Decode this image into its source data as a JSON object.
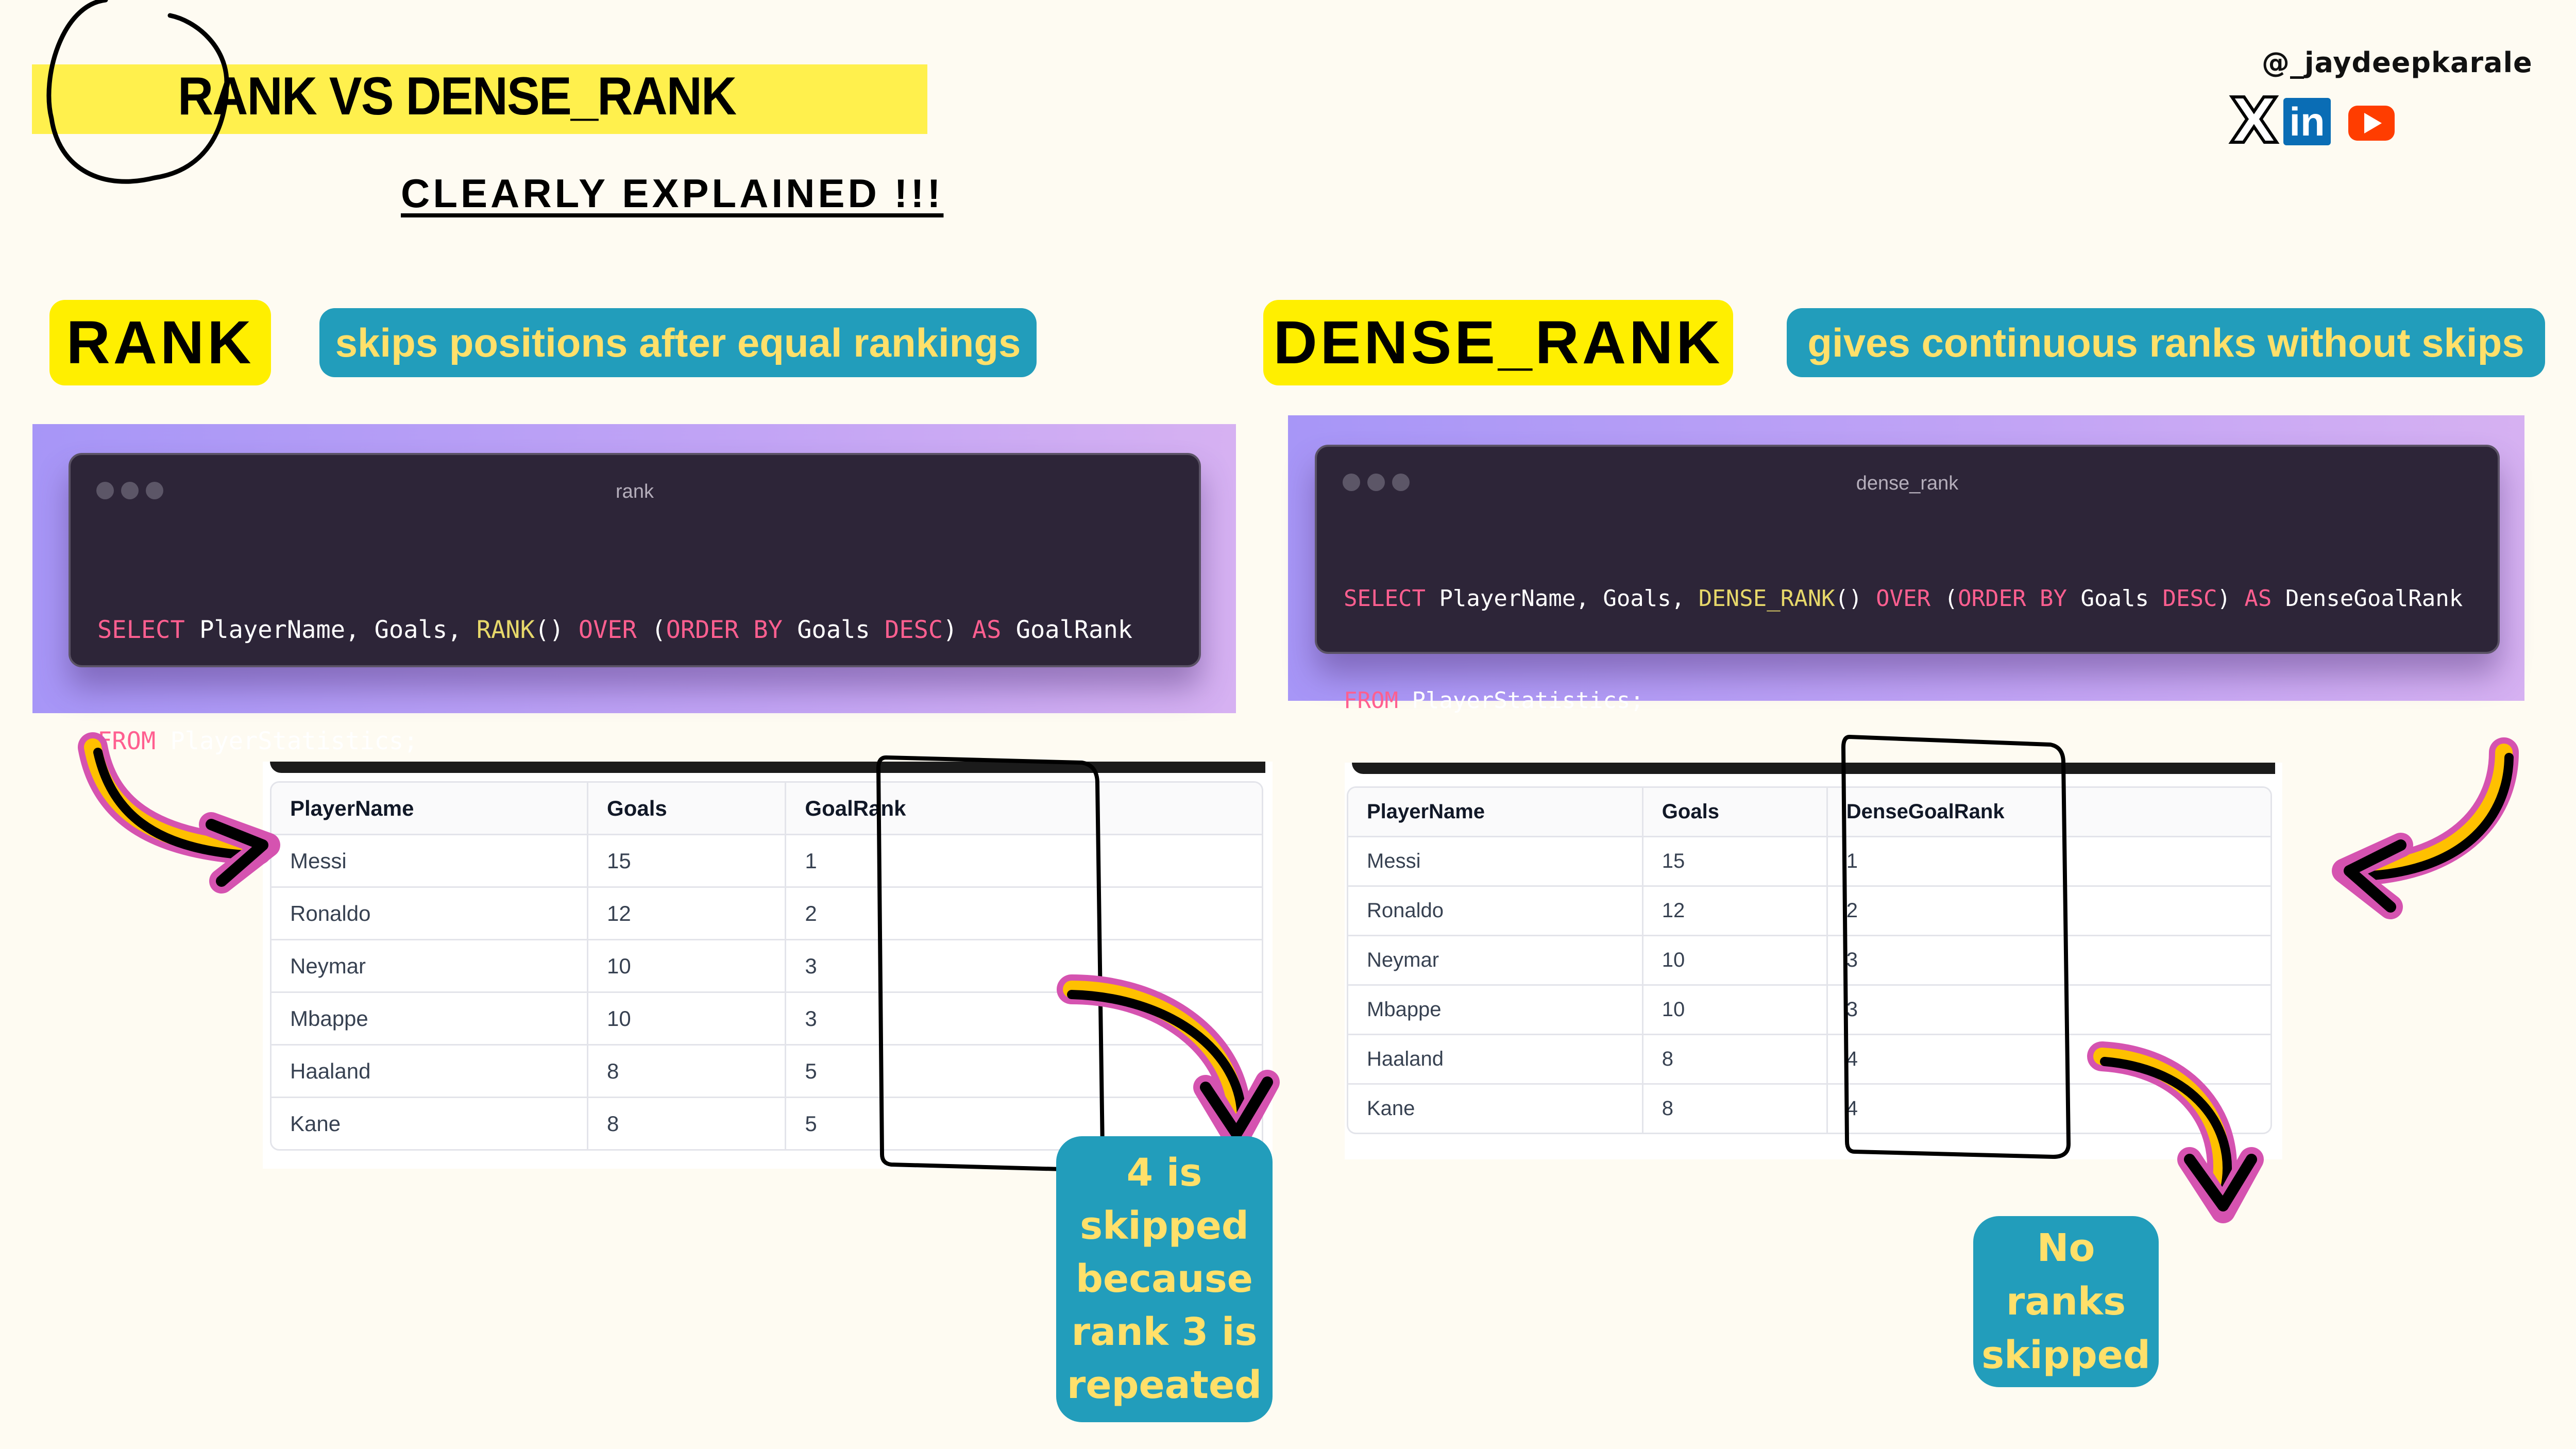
{
  "header": {
    "title": "RANK VS DENSE_RANK",
    "subtitle": "CLEARLY EXPLAINED !!!",
    "handle": "@_jaydeepkarale",
    "socials": [
      {
        "name": "x",
        "icon": "x-logo-icon",
        "glyph": "X"
      },
      {
        "name": "linkedin",
        "icon": "linkedin-icon",
        "glyph": "in"
      },
      {
        "name": "youtube",
        "icon": "youtube-icon",
        "glyph": ""
      }
    ]
  },
  "colors": {
    "background": "#fefbf2",
    "title_highlight": "#fff04d",
    "label_yellow": "#ffef00",
    "label_blue": "#229dbb",
    "label_text_yellow": "#ffe06a",
    "code_bg": "#2d2538",
    "code_keyword": "#ff5f90",
    "code_function": "#e7d86a",
    "arrow_pink": "#d553b0",
    "arrow_yellow": "#ffc000"
  },
  "rank": {
    "label": "RANK",
    "description": "skips positions after equal rankings",
    "code_window_title": "rank",
    "code": {
      "line1": [
        {
          "t": "SELECT",
          "c": "kw"
        },
        {
          "t": " PlayerName, Goals, ",
          "c": ""
        },
        {
          "t": "RANK",
          "c": "fn"
        },
        {
          "t": "() ",
          "c": ""
        },
        {
          "t": "OVER",
          "c": "kw"
        },
        {
          "t": " (",
          "c": ""
        },
        {
          "t": "ORDER BY",
          "c": "kw"
        },
        {
          "t": " Goals ",
          "c": ""
        },
        {
          "t": "DESC",
          "c": "kw"
        },
        {
          "t": ") ",
          "c": ""
        },
        {
          "t": "AS",
          "c": "kw"
        },
        {
          "t": " GoalRank",
          "c": ""
        }
      ],
      "line2": [
        {
          "t": "FROM",
          "c": "kw"
        },
        {
          "t": " PlayerStatistics;",
          "c": ""
        }
      ]
    },
    "table": {
      "columns": [
        "PlayerName",
        "Goals",
        "GoalRank"
      ],
      "rows": [
        [
          "Messi",
          "15",
          "1"
        ],
        [
          "Ronaldo",
          "12",
          "2"
        ],
        [
          "Neymar",
          "10",
          "3"
        ],
        [
          "Mbappe",
          "10",
          "3"
        ],
        [
          "Haaland",
          "8",
          "5"
        ],
        [
          "Kane",
          "8",
          "5"
        ]
      ]
    },
    "callout": [
      "4 is",
      "skipped",
      "because",
      "rank 3 is",
      "repeated"
    ]
  },
  "dense_rank": {
    "label": "DENSE_RANK",
    "description": "gives continuous ranks without skips",
    "code_window_title": "dense_rank",
    "code": {
      "line1": [
        {
          "t": "SELECT",
          "c": "kw"
        },
        {
          "t": " PlayerName, Goals, ",
          "c": ""
        },
        {
          "t": "DENSE_RANK",
          "c": "fn"
        },
        {
          "t": "() ",
          "c": ""
        },
        {
          "t": "OVER",
          "c": "kw"
        },
        {
          "t": " (",
          "c": ""
        },
        {
          "t": "ORDER BY",
          "c": "kw"
        },
        {
          "t": " Goals ",
          "c": ""
        },
        {
          "t": "DESC",
          "c": "kw"
        },
        {
          "t": ") ",
          "c": ""
        },
        {
          "t": "AS",
          "c": "kw"
        },
        {
          "t": " DenseGoalRank",
          "c": ""
        }
      ],
      "line2": [
        {
          "t": "FROM",
          "c": "kw"
        },
        {
          "t": " PlayerStatistics;",
          "c": ""
        }
      ]
    },
    "table": {
      "columns": [
        "PlayerName",
        "Goals",
        "DenseGoalRank"
      ],
      "rows": [
        [
          "Messi",
          "15",
          "1"
        ],
        [
          "Ronaldo",
          "12",
          "2"
        ],
        [
          "Neymar",
          "10",
          "3"
        ],
        [
          "Mbappe",
          "10",
          "3"
        ],
        [
          "Haaland",
          "8",
          "4"
        ],
        [
          "Kane",
          "8",
          "4"
        ]
      ]
    },
    "callout": [
      "No ranks",
      "skipped"
    ]
  }
}
